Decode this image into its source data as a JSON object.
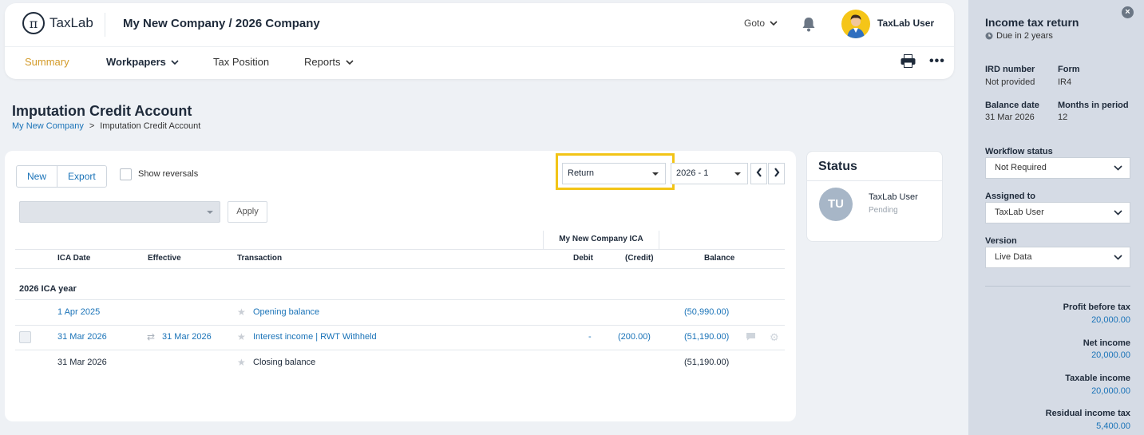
{
  "header": {
    "logo_symbol": "π",
    "logo_text": "TaxLab",
    "company": "My New Company / 2026 Company",
    "goto": "Goto",
    "user": "TaxLab User"
  },
  "nav": {
    "summary": "Summary",
    "workpapers": "Workpapers",
    "tax_position": "Tax Position",
    "reports": "Reports"
  },
  "page": {
    "title": "Imputation Credit Account",
    "breadcrumb_root": "My New Company",
    "breadcrumb_sep": ">",
    "breadcrumb_current": "Imputation Credit Account"
  },
  "toolbar": {
    "new": "New",
    "export": "Export",
    "show_reversals": "Show reversals",
    "return_select": "Return",
    "period_select": "2026 - 1",
    "apply": "Apply"
  },
  "table": {
    "group_header": "My New Company ICA",
    "columns": {
      "ica_date": "ICA Date",
      "effective": "Effective",
      "transaction": "Transaction",
      "debit": "Debit",
      "credit": "(Credit)",
      "balance": "Balance"
    },
    "section": "2026 ICA year",
    "rows": [
      {
        "ica_date": "1 Apr 2025",
        "effective": "",
        "transaction": "Opening balance",
        "debit": "",
        "credit": "",
        "balance": "(50,990.00)"
      },
      {
        "ica_date": "31 Mar 2026",
        "effective": "31 Mar 2026",
        "transaction": "Interest income | RWT Withheld",
        "debit": "-",
        "credit": "(200.00)",
        "balance": "(51,190.00)"
      },
      {
        "ica_date": "31 Mar 2026",
        "effective": "",
        "transaction": "Closing balance",
        "debit": "",
        "credit": "",
        "balance": "(51,190.00)"
      }
    ]
  },
  "status": {
    "title": "Status",
    "initials": "TU",
    "user": "TaxLab User",
    "state": "Pending"
  },
  "side": {
    "close": "×",
    "title": "Income tax return",
    "due": "Due in 2 years",
    "ird_label": "IRD number",
    "ird_value": "Not provided",
    "form_label": "Form",
    "form_value": "IR4",
    "balance_date_label": "Balance date",
    "balance_date_value": "31 Mar 2026",
    "months_label": "Months in period",
    "months_value": "12",
    "workflow_label": "Workflow status",
    "workflow_value": "Not Required",
    "assigned_label": "Assigned to",
    "assigned_value": "TaxLab User",
    "version_label": "Version",
    "version_value": "Live Data",
    "profit_label": "Profit before tax",
    "profit_value": "20,000.00",
    "net_label": "Net income",
    "net_value": "20,000.00",
    "taxable_label": "Taxable income",
    "taxable_value": "20,000.00",
    "residual_label": "Residual income tax",
    "residual_value": "5,400.00"
  },
  "colors": {
    "accent": "#d39b2a",
    "link": "#1a73b8",
    "highlight": "#f2c417"
  }
}
